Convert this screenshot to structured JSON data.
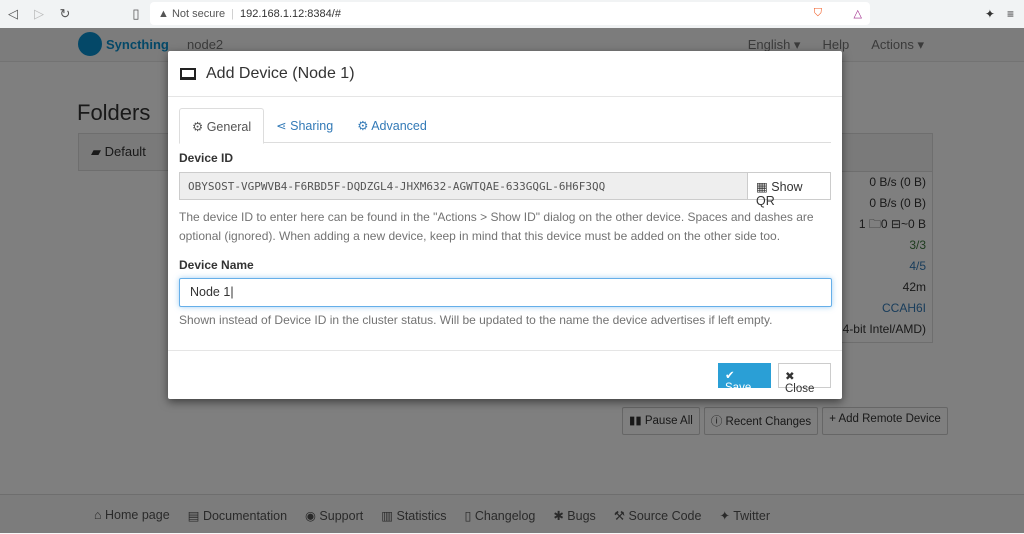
{
  "browser": {
    "not_secure": "Not secure",
    "url": "192.168.1.12:8384/#"
  },
  "nav": {
    "brand": "Syncthing",
    "node": "node2",
    "language": "English ▾",
    "help": "Help",
    "actions": "Actions ▾"
  },
  "main": {
    "folders_title": "Folders",
    "folder": "Default",
    "stats": [
      "0 B/s (0 B)",
      "0 B/s (0 B)",
      "1 🗀0 ⊟~0 B",
      "3/3",
      "4/5",
      "42m",
      "CCAH6I",
      "4-bit Intel/AMD)"
    ],
    "buttons": [
      "Pause All",
      "Recent Changes",
      "Add Remote Device"
    ]
  },
  "footer": [
    "Home page",
    "Documentation",
    "Support",
    "Statistics",
    "Changelog",
    "Bugs",
    "Source Code",
    "Twitter"
  ],
  "modal": {
    "title": "Add Device (Node 1)",
    "tabs": [
      "General",
      "Sharing",
      "Advanced"
    ],
    "device_id_label": "Device ID",
    "device_id": "OBYSOST-VGPWVB4-F6RBD5F-DQDZGL4-JHXM632-AGWTQAE-633GQGL-6H6F3QQ",
    "show_qr": "Show QR",
    "device_id_help": "The device ID to enter here can be found in the \"Actions > Show ID\" dialog on the other device. Spaces and dashes are optional (ignored). When adding a new device, keep in mind that this device must be added on the other side too.",
    "device_name_label": "Device Name",
    "device_name": "Node 1",
    "device_name_help": "Shown instead of Device ID in the cluster status. Will be updated to the name the device advertises if left empty.",
    "save": "Save",
    "close": "Close"
  }
}
